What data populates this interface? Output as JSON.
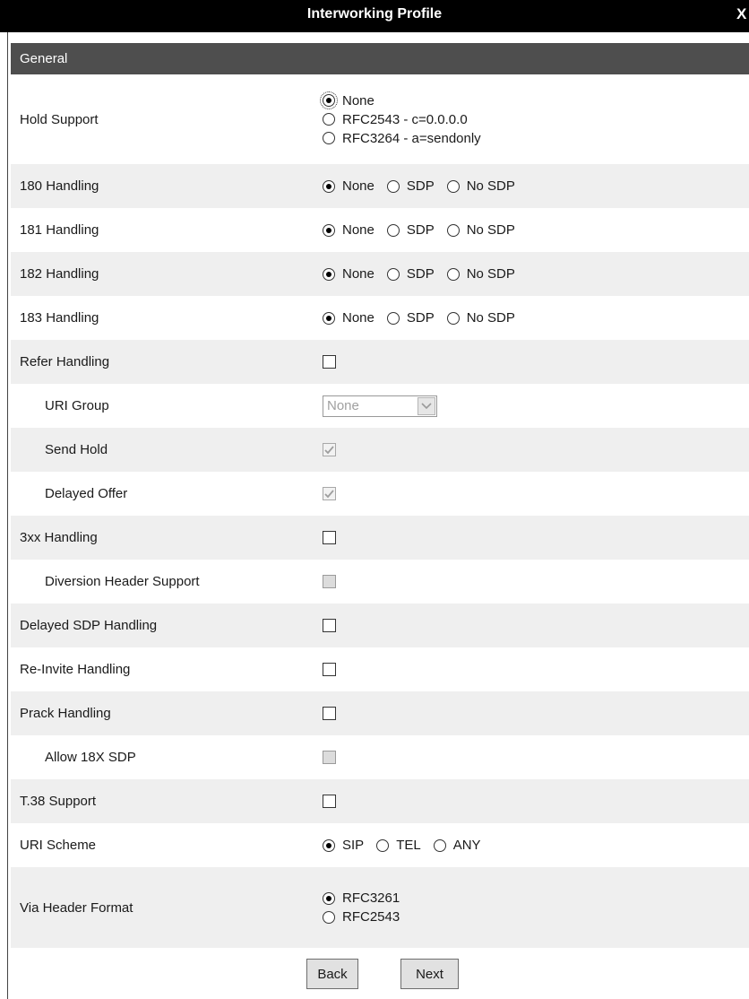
{
  "window": {
    "title": "Interworking Profile",
    "close_label": "X"
  },
  "section": {
    "title": "General"
  },
  "hold_support": {
    "label": "Hold Support",
    "options": [
      "None",
      "RFC2543 - c=0.0.0.0",
      "RFC3264 - a=sendonly"
    ],
    "selected": "None"
  },
  "handling_180": {
    "label": "180 Handling",
    "options": [
      "None",
      "SDP",
      "No SDP"
    ],
    "selected": "None"
  },
  "handling_181": {
    "label": "181 Handling",
    "options": [
      "None",
      "SDP",
      "No SDP"
    ],
    "selected": "None"
  },
  "handling_182": {
    "label": "182 Handling",
    "options": [
      "None",
      "SDP",
      "No SDP"
    ],
    "selected": "None"
  },
  "handling_183": {
    "label": "183 Handling",
    "options": [
      "None",
      "SDP",
      "No SDP"
    ],
    "selected": "None"
  },
  "refer_handling": {
    "label": "Refer Handling",
    "checked": false
  },
  "uri_group": {
    "label": "URI Group",
    "value": "None",
    "disabled": true
  },
  "send_hold": {
    "label": "Send Hold",
    "checked": true,
    "disabled": true
  },
  "delayed_offer": {
    "label": "Delayed Offer",
    "checked": true,
    "disabled": true
  },
  "handling_3xx": {
    "label": "3xx Handling",
    "checked": false
  },
  "diversion_header": {
    "label": "Diversion Header Support",
    "checked": false,
    "disabled": true
  },
  "delayed_sdp": {
    "label": "Delayed SDP Handling",
    "checked": false
  },
  "reinvite": {
    "label": "Re-Invite Handling",
    "checked": false
  },
  "prack": {
    "label": "Prack Handling",
    "checked": false
  },
  "allow_18x_sdp": {
    "label": "Allow 18X SDP",
    "checked": false,
    "disabled": true
  },
  "t38": {
    "label": "T.38 Support",
    "checked": false
  },
  "uri_scheme": {
    "label": "URI Scheme",
    "options": [
      "SIP",
      "TEL",
      "ANY"
    ],
    "selected": "SIP"
  },
  "via_header": {
    "label": "Via Header Format",
    "options": [
      "RFC3261",
      "RFC2543"
    ],
    "selected": "RFC3261"
  },
  "buttons": {
    "back": "Back",
    "next": "Next"
  }
}
